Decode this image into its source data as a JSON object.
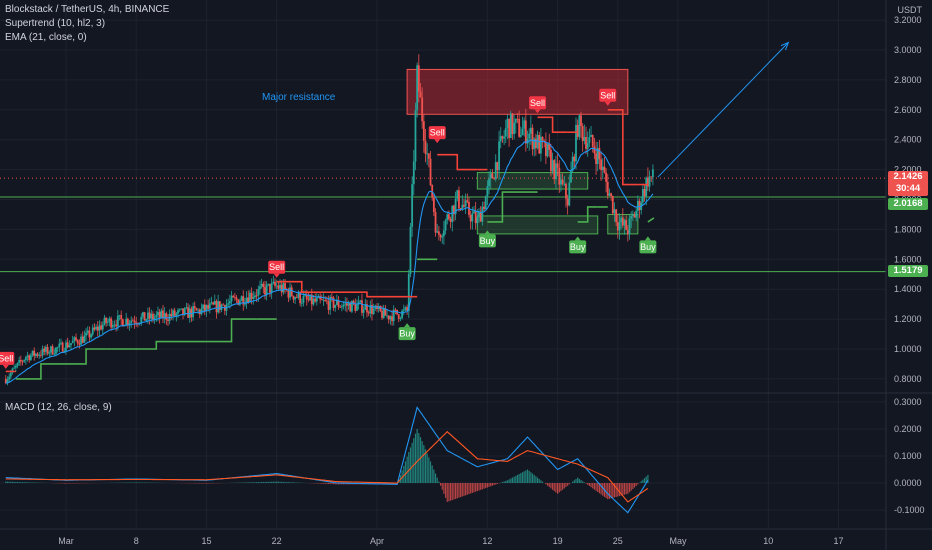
{
  "header": {
    "title": "Blockstack / TetherUS, 4h, BINANCE",
    "indicator1": "Supertrend (10, hl2, 3)",
    "indicator2": "EMA (21, close, 0)",
    "macd_label": "MACD (12, 26, close, 9)",
    "currency": "USDT"
  },
  "annotation": {
    "major_resistance": "Major resistance"
  },
  "price_tags": {
    "last_price": "2.1426",
    "countdown": "30:44",
    "support_upper": "2.0168",
    "support_lower": "1.5179"
  },
  "colors": {
    "background": "#131722",
    "up": "#26a69a",
    "down": "#ef5350",
    "supertrend_up": "#4caf50",
    "supertrend_down": "#f44336",
    "ema": "#2196f3",
    "resistance_zone": "#b22833",
    "support_line": "#4caf50",
    "annotation_text": "#2196f3",
    "macd_line": "#2196f3",
    "signal_line": "#ff5722"
  },
  "chart_data": [
    {
      "type": "candlestick",
      "title": "Blockstack / TetherUS, 4h, BINANCE",
      "y_unit": "USDT",
      "y_ticks": [
        "3.2000",
        "3.0000",
        "2.8000",
        "2.6000",
        "2.4000",
        "2.2000",
        "2.0000",
        "1.8000",
        "1.6000",
        "1.4000",
        "1.2000",
        "1.0000",
        "0.8000"
      ],
      "ylim": [
        0.72,
        3.25
      ],
      "x_ticks": [
        "Mar",
        "8",
        "15",
        "22",
        "Apr",
        "12",
        "19",
        "25",
        "May",
        "10",
        "17"
      ],
      "close_path": [
        {
          "x": "Feb 23",
          "y": 0.8
        },
        {
          "x": "Feb 25",
          "y": 0.95
        },
        {
          "x": "Feb 28",
          "y": 1.0
        },
        {
          "x": "Mar 3",
          "y": 1.08
        },
        {
          "x": "Mar 5",
          "y": 1.18
        },
        {
          "x": "Mar 8",
          "y": 1.2
        },
        {
          "x": "Mar 11",
          "y": 1.22
        },
        {
          "x": "Mar 14",
          "y": 1.25
        },
        {
          "x": "Mar 17",
          "y": 1.3
        },
        {
          "x": "Mar 20",
          "y": 1.38
        },
        {
          "x": "Mar 22",
          "y": 1.42
        },
        {
          "x": "Mar 25",
          "y": 1.32
        },
        {
          "x": "Mar 28",
          "y": 1.3
        },
        {
          "x": "Mar 31",
          "y": 1.28
        },
        {
          "x": "Apr 2",
          "y": 1.22
        },
        {
          "x": "Apr 4",
          "y": 1.25
        },
        {
          "x": "Apr 5",
          "y": 2.82
        },
        {
          "x": "Apr 6",
          "y": 2.3
        },
        {
          "x": "Apr 7",
          "y": 1.75
        },
        {
          "x": "Apr 9",
          "y": 2.0
        },
        {
          "x": "Apr 11",
          "y": 1.85
        },
        {
          "x": "Apr 12",
          "y": 2.05
        },
        {
          "x": "Apr 14",
          "y": 2.5
        },
        {
          "x": "Apr 16",
          "y": 2.45
        },
        {
          "x": "Apr 18",
          "y": 2.3
        },
        {
          "x": "Apr 20",
          "y": 2.0
        },
        {
          "x": "Apr 21",
          "y": 2.5
        },
        {
          "x": "Apr 23",
          "y": 2.3
        },
        {
          "x": "Apr 25",
          "y": 1.85
        },
        {
          "x": "Apr 26",
          "y": 1.8
        },
        {
          "x": "Apr 27",
          "y": 1.95
        },
        {
          "x": "Apr 28",
          "y": 2.14
        }
      ],
      "supertrend": [
        {
          "x": "Feb 23",
          "y": 0.85,
          "dir": "down"
        },
        {
          "x": "Feb 24",
          "y": 0.8,
          "dir": "up"
        },
        {
          "x": "Mar 1",
          "y": 0.9,
          "dir": "up"
        },
        {
          "x": "Mar 5",
          "y": 1.0,
          "dir": "up"
        },
        {
          "x": "Mar 15",
          "y": 1.05,
          "dir": "up"
        },
        {
          "x": "Mar 20",
          "y": 1.2,
          "dir": "up"
        },
        {
          "x": "Mar 22",
          "y": 1.45,
          "dir": "down"
        },
        {
          "x": "Mar 27",
          "y": 1.38,
          "dir": "down"
        },
        {
          "x": "Apr 4",
          "y": 1.35,
          "dir": "down"
        },
        {
          "x": "Apr 5",
          "y": 1.6,
          "dir": "up"
        },
        {
          "x": "Apr 7",
          "y": 2.3,
          "dir": "down"
        },
        {
          "x": "Apr 11",
          "y": 2.2,
          "dir": "down"
        },
        {
          "x": "Apr 12",
          "y": 1.85,
          "dir": "up"
        },
        {
          "x": "Apr 15",
          "y": 2.05,
          "dir": "up"
        },
        {
          "x": "Apr 17",
          "y": 2.55,
          "dir": "down"
        },
        {
          "x": "Apr 20",
          "y": 2.45,
          "dir": "down"
        },
        {
          "x": "Apr 21",
          "y": 1.85,
          "dir": "up"
        },
        {
          "x": "Apr 23",
          "y": 1.95,
          "dir": "up"
        },
        {
          "x": "Apr 24",
          "y": 2.6,
          "dir": "down"
        },
        {
          "x": "Apr 27",
          "y": 2.1,
          "dir": "down"
        },
        {
          "x": "Apr 28",
          "y": 1.85,
          "dir": "up"
        }
      ],
      "signals": [
        {
          "label": "Sell",
          "x": "Feb 23",
          "y": 0.86,
          "type": "sell"
        },
        {
          "label": "Sell",
          "x": "Mar 22",
          "y": 1.47,
          "type": "sell"
        },
        {
          "label": "Buy",
          "x": "Apr 4",
          "y": 1.18,
          "type": "buy"
        },
        {
          "label": "Sell",
          "x": "Apr 7",
          "y": 2.37,
          "type": "sell"
        },
        {
          "label": "Buy",
          "x": "Apr 12",
          "y": 1.8,
          "type": "buy"
        },
        {
          "label": "Sell",
          "x": "Apr 17",
          "y": 2.57,
          "type": "sell"
        },
        {
          "label": "Buy",
          "x": "Apr 21",
          "y": 1.76,
          "type": "buy"
        },
        {
          "label": "Sell",
          "x": "Apr 24",
          "y": 2.62,
          "type": "sell"
        },
        {
          "label": "Buy",
          "x": "Apr 28",
          "y": 1.76,
          "type": "buy"
        }
      ],
      "resistance_zone": {
        "x_start": "Apr 4",
        "x_end": "Apr 26",
        "y_low": 2.57,
        "y_high": 2.87
      },
      "support_boxes": [
        {
          "x_start": "Apr 11",
          "x_end": "Apr 22",
          "y_low": 2.07,
          "y_high": 2.18
        },
        {
          "x_start": "Apr 11",
          "x_end": "Apr 23",
          "y_low": 1.77,
          "y_high": 1.89
        },
        {
          "x_start": "Apr 24",
          "x_end": "Apr 27",
          "y_low": 1.77,
          "y_high": 1.9
        }
      ],
      "horizontal_lines": [
        2.0168,
        1.5179
      ],
      "dotted_line": 2.1426,
      "projection_arrow": {
        "from": {
          "x": "Apr 29",
          "y": 2.15
        },
        "to": {
          "x": "May 12",
          "y": 3.05
        }
      }
    },
    {
      "type": "macd",
      "title": "MACD (12, 26, close, 9)",
      "y_ticks": [
        "0.3000",
        "0.2000",
        "0.1000",
        "0.0000",
        "-0.1000"
      ],
      "ylim": [
        -0.135,
        0.31
      ],
      "macd": [
        {
          "x": "Feb 23",
          "y": 0.02
        },
        {
          "x": "Mar 1",
          "y": 0.01
        },
        {
          "x": "Mar 8",
          "y": 0.015
        },
        {
          "x": "Mar 15",
          "y": 0.01
        },
        {
          "x": "Mar 22",
          "y": 0.035
        },
        {
          "x": "Mar 28",
          "y": 0.0
        },
        {
          "x": "Apr 3",
          "y": -0.005
        },
        {
          "x": "Apr 5",
          "y": 0.28
        },
        {
          "x": "Apr 8",
          "y": 0.12
        },
        {
          "x": "Apr 11",
          "y": 0.06
        },
        {
          "x": "Apr 14",
          "y": 0.09
        },
        {
          "x": "Apr 16",
          "y": 0.17
        },
        {
          "x": "Apr 19",
          "y": 0.05
        },
        {
          "x": "Apr 21",
          "y": 0.09
        },
        {
          "x": "Apr 24",
          "y": -0.04
        },
        {
          "x": "Apr 26",
          "y": -0.11
        },
        {
          "x": "Apr 28",
          "y": 0.01
        }
      ],
      "signal": [
        {
          "x": "Feb 23",
          "y": 0.015
        },
        {
          "x": "Mar 1",
          "y": 0.012
        },
        {
          "x": "Mar 8",
          "y": 0.013
        },
        {
          "x": "Mar 15",
          "y": 0.012
        },
        {
          "x": "Mar 22",
          "y": 0.03
        },
        {
          "x": "Mar 28",
          "y": 0.005
        },
        {
          "x": "Apr 3",
          "y": 0.0
        },
        {
          "x": "Apr 5",
          "y": 0.08
        },
        {
          "x": "Apr 8",
          "y": 0.19
        },
        {
          "x": "Apr 11",
          "y": 0.09
        },
        {
          "x": "Apr 14",
          "y": 0.08
        },
        {
          "x": "Apr 16",
          "y": 0.12
        },
        {
          "x": "Apr 19",
          "y": 0.09
        },
        {
          "x": "Apr 21",
          "y": 0.07
        },
        {
          "x": "Apr 24",
          "y": 0.02
        },
        {
          "x": "Apr 26",
          "y": -0.07
        },
        {
          "x": "Apr 28",
          "y": -0.02
        }
      ]
    }
  ]
}
